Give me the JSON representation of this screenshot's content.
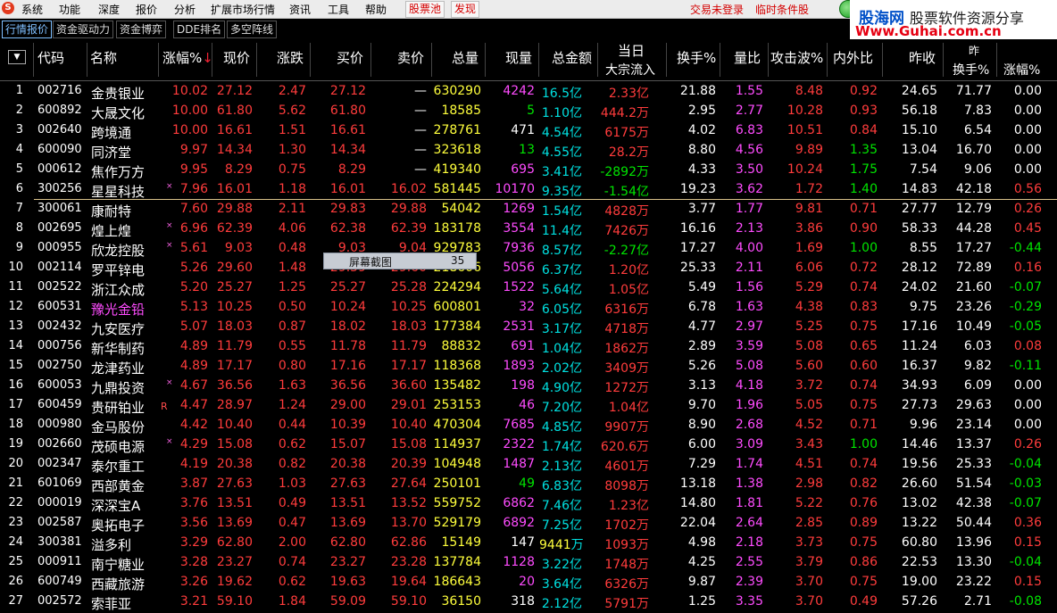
{
  "menubar": {
    "logo": "S",
    "items": [
      "系统",
      "功能",
      "深度",
      "报价",
      "分析",
      "扩展市场行情",
      "资讯",
      "工具",
      "帮助"
    ],
    "pills": [
      "股票池",
      "发现"
    ],
    "status": [
      "交易未登录",
      "临时条件股"
    ]
  },
  "watermark": {
    "title_a": "股海网",
    "title_b": "股票软件资源分享",
    "url": "Www.Guhai.com.cn"
  },
  "tabs": [
    "行情报价",
    "资金驱动力",
    "资金博弈",
    "DDE排名",
    "多空阵线"
  ],
  "header": {
    "code": "代码",
    "name": "名称",
    "pct": "涨幅%",
    "price": "现价",
    "chg": "涨跌",
    "bid": "买价",
    "ask": "卖价",
    "vol": "总量",
    "cur": "现量",
    "amount": "总金额",
    "today": "当日",
    "inflow": "大宗流入",
    "turnover": "换手%",
    "volratio": "量比",
    "attack": "攻击波%",
    "inout": "内外比",
    "prevclose": "昨收",
    "extra_top": "昨",
    "turnover2": "换手%",
    "pct2": "涨幅%"
  },
  "popup": {
    "label": "屏幕截图",
    "value": "35"
  },
  "colors": {
    "red": "#ff3c3c",
    "green": "#00e400",
    "cyan": "#00e0e0",
    "yellow": "#ffff3c",
    "magenta": "#ff4cff",
    "white": "#ffffff"
  },
  "rows": [
    {
      "i": "1",
      "code": "002716",
      "name": "金贵银业",
      "pct": "10.02",
      "price": "27.12",
      "chg": "2.47",
      "bid": "27.12",
      "ask": "—",
      "vol": "630290",
      "cur": "4242",
      "amt": "16.5",
      "amtu": "亿",
      "flow": "2.33",
      "flowu": "亿",
      "to": "21.88",
      "vr": "1.55",
      "aw": "8.48",
      "io": "0.92",
      "pc": "24.65",
      "to2": "71.77",
      "p2": "0.00",
      "pcol": "red",
      "curcol": "magenta",
      "flowcol": "red",
      "p2col": "white"
    },
    {
      "i": "2",
      "code": "600892",
      "name": "大晟文化",
      "pct": "10.00",
      "price": "61.80",
      "chg": "5.62",
      "bid": "61.80",
      "ask": "—",
      "vol": "18585",
      "cur": "5",
      "amt": "1.10",
      "amtu": "亿",
      "flow": "444.2",
      "flowu": "万",
      "to": "2.95",
      "vr": "2.77",
      "aw": "10.28",
      "io": "0.93",
      "pc": "56.18",
      "to2": "7.83",
      "p2": "0.00",
      "pcol": "red",
      "curcol": "green",
      "flowcol": "red",
      "p2col": "white"
    },
    {
      "i": "3",
      "code": "002640",
      "name": "跨境通",
      "pct": "10.00",
      "price": "16.61",
      "chg": "1.51",
      "bid": "16.61",
      "ask": "—",
      "vol": "278761",
      "cur": "471",
      "amt": "4.54",
      "amtu": "亿",
      "flow": "6175",
      "flowu": "万",
      "to": "4.02",
      "vr": "6.83",
      "aw": "10.51",
      "io": "0.84",
      "pc": "15.10",
      "to2": "6.54",
      "p2": "0.00",
      "pcol": "red",
      "curcol": "white",
      "flowcol": "red",
      "p2col": "white"
    },
    {
      "i": "4",
      "code": "600090",
      "name": "同济堂",
      "pct": "9.97",
      "price": "14.34",
      "chg": "1.30",
      "bid": "14.34",
      "ask": "—",
      "vol": "323618",
      "cur": "13",
      "amt": "4.55",
      "amtu": "亿",
      "flow": "28.2",
      "flowu": "万",
      "to": "8.80",
      "vr": "4.56",
      "aw": "9.89",
      "io": "1.35",
      "pc": "13.04",
      "to2": "16.70",
      "p2": "0.00",
      "pcol": "red",
      "curcol": "green",
      "flowcol": "red",
      "p2col": "white",
      "iocol": "green"
    },
    {
      "i": "5",
      "code": "000612",
      "name": "焦作万方",
      "pct": "9.95",
      "price": "8.29",
      "chg": "0.75",
      "bid": "8.29",
      "ask": "—",
      "vol": "419340",
      "cur": "695",
      "amt": "3.41",
      "amtu": "亿",
      "flow": "-2892",
      "flowu": "万",
      "to": "4.33",
      "vr": "3.50",
      "aw": "10.24",
      "io": "1.75",
      "pc": "7.54",
      "to2": "9.06",
      "p2": "0.00",
      "pcol": "red",
      "curcol": "magenta",
      "flowcol": "green",
      "p2col": "white",
      "iocol": "green"
    },
    {
      "i": "6",
      "code": "300256",
      "name": "星星科技",
      "pct": "7.96",
      "price": "16.01",
      "chg": "1.18",
      "bid": "16.01",
      "ask": "16.02",
      "vol": "581445",
      "cur": "10170",
      "amt": "9.35",
      "amtu": "亿",
      "flow": "-1.54",
      "flowu": "亿",
      "to": "19.23",
      "vr": "3.62",
      "aw": "1.72",
      "io": "1.40",
      "pc": "14.83",
      "to2": "42.18",
      "p2": "0.56",
      "pcol": "red",
      "curcol": "magenta",
      "flowcol": "green",
      "p2col": "red",
      "iocol": "green",
      "mark": "×"
    },
    {
      "i": "7",
      "code": "300061",
      "name": "康耐特",
      "pct": "7.60",
      "price": "29.88",
      "chg": "2.11",
      "bid": "29.83",
      "ask": "29.88",
      "vol": "54042",
      "cur": "1269",
      "amt": "1.54",
      "amtu": "亿",
      "flow": "4828",
      "flowu": "万",
      "to": "3.77",
      "vr": "1.77",
      "aw": "9.81",
      "io": "0.71",
      "pc": "27.77",
      "to2": "12.79",
      "p2": "0.26",
      "pcol": "red",
      "curcol": "magenta",
      "flowcol": "red",
      "p2col": "red"
    },
    {
      "i": "8",
      "code": "002695",
      "name": "煌上煌",
      "pct": "6.96",
      "price": "62.39",
      "chg": "4.06",
      "bid": "62.38",
      "ask": "62.39",
      "vol": "183178",
      "cur": "3554",
      "amt": "11.4",
      "amtu": "亿",
      "flow": "7426",
      "flowu": "万",
      "to": "16.16",
      "vr": "2.13",
      "aw": "3.86",
      "io": "0.90",
      "pc": "58.33",
      "to2": "44.28",
      "p2": "0.45",
      "pcol": "red",
      "curcol": "magenta",
      "flowcol": "red",
      "p2col": "red",
      "mark": "×"
    },
    {
      "i": "9",
      "code": "000955",
      "name": "欣龙控股",
      "pct": "5.61",
      "price": "9.03",
      "chg": "0.48",
      "bid": "9.03",
      "ask": "9.04",
      "vol": "929783",
      "cur": "7936",
      "amt": "8.57",
      "amtu": "亿",
      "flow": "-2.27",
      "flowu": "亿",
      "to": "17.27",
      "vr": "4.00",
      "aw": "1.69",
      "io": "1.00",
      "pc": "8.55",
      "to2": "17.27",
      "p2": "-0.44",
      "pcol": "red",
      "curcol": "magenta",
      "flowcol": "green",
      "p2col": "green",
      "iocol": "green",
      "mark": "×"
    },
    {
      "i": "10",
      "code": "002114",
      "name": "罗平锌电",
      "pct": "5.26",
      "price": "29.60",
      "chg": "1.48",
      "bid": "29.59",
      "ask": "29.60",
      "vol": "218606",
      "cur": "5056",
      "amt": "6.37",
      "amtu": "亿",
      "flow": "1.20",
      "flowu": "亿",
      "to": "25.33",
      "vr": "2.11",
      "aw": "6.06",
      "io": "0.72",
      "pc": "28.12",
      "to2": "72.89",
      "p2": "0.16",
      "pcol": "red",
      "curcol": "magenta",
      "flowcol": "red",
      "p2col": "red"
    },
    {
      "i": "11",
      "code": "002522",
      "name": "浙江众成",
      "pct": "5.20",
      "price": "25.27",
      "chg": "1.25",
      "bid": "25.27",
      "ask": "25.28",
      "vol": "224294",
      "cur": "1522",
      "amt": "5.64",
      "amtu": "亿",
      "flow": "1.05",
      "flowu": "亿",
      "to": "5.49",
      "vr": "1.56",
      "aw": "5.29",
      "io": "0.74",
      "pc": "24.02",
      "to2": "21.60",
      "p2": "-0.07",
      "pcol": "red",
      "curcol": "magenta",
      "flowcol": "red",
      "p2col": "green"
    },
    {
      "i": "12",
      "code": "600531",
      "name": "豫光金铅",
      "pct": "5.13",
      "price": "10.25",
      "chg": "0.50",
      "bid": "10.24",
      "ask": "10.25",
      "vol": "600801",
      "cur": "32",
      "amt": "6.05",
      "amtu": "亿",
      "flow": "6316",
      "flowu": "万",
      "to": "6.78",
      "vr": "1.63",
      "aw": "4.38",
      "io": "0.83",
      "pc": "9.75",
      "to2": "23.26",
      "p2": "-0.29",
      "pcol": "red",
      "curcol": "magenta",
      "flowcol": "red",
      "p2col": "green",
      "namecol": "magenta"
    },
    {
      "i": "13",
      "code": "002432",
      "name": "九安医疗",
      "pct": "5.07",
      "price": "18.03",
      "chg": "0.87",
      "bid": "18.02",
      "ask": "18.03",
      "vol": "177384",
      "cur": "2531",
      "amt": "3.17",
      "amtu": "亿",
      "flow": "4718",
      "flowu": "万",
      "to": "4.77",
      "vr": "2.97",
      "aw": "5.25",
      "io": "0.75",
      "pc": "17.16",
      "to2": "10.49",
      "p2": "-0.05",
      "pcol": "red",
      "curcol": "magenta",
      "flowcol": "red",
      "p2col": "green"
    },
    {
      "i": "14",
      "code": "000756",
      "name": "新华制药",
      "pct": "4.89",
      "price": "11.79",
      "chg": "0.55",
      "bid": "11.78",
      "ask": "11.79",
      "vol": "88832",
      "cur": "691",
      "amt": "1.04",
      "amtu": "亿",
      "flow": "1862",
      "flowu": "万",
      "to": "2.89",
      "vr": "3.59",
      "aw": "5.08",
      "io": "0.65",
      "pc": "11.24",
      "to2": "6.03",
      "p2": "0.08",
      "pcol": "red",
      "curcol": "magenta",
      "flowcol": "red",
      "p2col": "red"
    },
    {
      "i": "15",
      "code": "002750",
      "name": "龙津药业",
      "pct": "4.89",
      "price": "17.17",
      "chg": "0.80",
      "bid": "17.16",
      "ask": "17.17",
      "vol": "118368",
      "cur": "1893",
      "amt": "2.02",
      "amtu": "亿",
      "flow": "3409",
      "flowu": "万",
      "to": "5.26",
      "vr": "5.08",
      "aw": "5.60",
      "io": "0.60",
      "pc": "16.37",
      "to2": "9.82",
      "p2": "-0.11",
      "pcol": "red",
      "curcol": "magenta",
      "flowcol": "red",
      "p2col": "green"
    },
    {
      "i": "16",
      "code": "600053",
      "name": "九鼎投资",
      "pct": "4.67",
      "price": "36.56",
      "chg": "1.63",
      "bid": "36.56",
      "ask": "36.60",
      "vol": "135482",
      "cur": "198",
      "amt": "4.90",
      "amtu": "亿",
      "flow": "1272",
      "flowu": "万",
      "to": "3.13",
      "vr": "4.18",
      "aw": "3.72",
      "io": "0.74",
      "pc": "34.93",
      "to2": "6.09",
      "p2": "0.00",
      "pcol": "red",
      "curcol": "magenta",
      "flowcol": "red",
      "p2col": "white",
      "mark": "×"
    },
    {
      "i": "17",
      "code": "600459",
      "name": "贵研铂业",
      "pct": "4.47",
      "price": "28.97",
      "chg": "1.24",
      "bid": "29.00",
      "ask": "29.01",
      "vol": "253153",
      "cur": "46",
      "amt": "7.20",
      "amtu": "亿",
      "flow": "1.04",
      "flowu": "亿",
      "to": "9.70",
      "vr": "1.96",
      "aw": "5.05",
      "io": "0.75",
      "pc": "27.73",
      "to2": "29.63",
      "p2": "0.00",
      "pcol": "red",
      "curcol": "magenta",
      "flowcol": "red",
      "p2col": "white",
      "mark": "R"
    },
    {
      "i": "18",
      "code": "000980",
      "name": "金马股份",
      "pct": "4.42",
      "price": "10.40",
      "chg": "0.44",
      "bid": "10.39",
      "ask": "10.40",
      "vol": "470304",
      "cur": "7685",
      "amt": "4.85",
      "amtu": "亿",
      "flow": "9907",
      "flowu": "万",
      "to": "8.90",
      "vr": "2.68",
      "aw": "4.52",
      "io": "0.71",
      "pc": "9.96",
      "to2": "23.14",
      "p2": "0.00",
      "pcol": "red",
      "curcol": "magenta",
      "flowcol": "red",
      "p2col": "white"
    },
    {
      "i": "19",
      "code": "002660",
      "name": "茂硕电源",
      "pct": "4.29",
      "price": "15.08",
      "chg": "0.62",
      "bid": "15.07",
      "ask": "15.08",
      "vol": "114937",
      "cur": "2322",
      "amt": "1.74",
      "amtu": "亿",
      "flow": "620.6",
      "flowu": "万",
      "to": "6.00",
      "vr": "3.09",
      "aw": "3.43",
      "io": "1.00",
      "pc": "14.46",
      "to2": "13.37",
      "p2": "0.26",
      "pcol": "red",
      "curcol": "magenta",
      "flowcol": "red",
      "p2col": "red",
      "iocol": "green",
      "mark": "×"
    },
    {
      "i": "20",
      "code": "002347",
      "name": "泰尔重工",
      "pct": "4.19",
      "price": "20.38",
      "chg": "0.82",
      "bid": "20.38",
      "ask": "20.39",
      "vol": "104948",
      "cur": "1487",
      "amt": "2.13",
      "amtu": "亿",
      "flow": "4601",
      "flowu": "万",
      "to": "7.29",
      "vr": "1.74",
      "aw": "4.51",
      "io": "0.74",
      "pc": "19.56",
      "to2": "25.33",
      "p2": "-0.04",
      "pcol": "red",
      "curcol": "magenta",
      "flowcol": "red",
      "p2col": "green"
    },
    {
      "i": "21",
      "code": "601069",
      "name": "西部黄金",
      "pct": "3.87",
      "price": "27.63",
      "chg": "1.03",
      "bid": "27.63",
      "ask": "27.64",
      "vol": "250101",
      "cur": "49",
      "amt": "6.83",
      "amtu": "亿",
      "flow": "8098",
      "flowu": "万",
      "to": "13.18",
      "vr": "1.38",
      "aw": "2.98",
      "io": "0.82",
      "pc": "26.60",
      "to2": "51.54",
      "p2": "-0.03",
      "pcol": "red",
      "curcol": "green",
      "flowcol": "red",
      "p2col": "green"
    },
    {
      "i": "22",
      "code": "000019",
      "name": "深深宝A",
      "pct": "3.76",
      "price": "13.51",
      "chg": "0.49",
      "bid": "13.51",
      "ask": "13.52",
      "vol": "559752",
      "cur": "6862",
      "amt": "7.46",
      "amtu": "亿",
      "flow": "1.23",
      "flowu": "亿",
      "to": "14.80",
      "vr": "1.81",
      "aw": "5.22",
      "io": "0.76",
      "pc": "13.02",
      "to2": "42.38",
      "p2": "-0.07",
      "pcol": "red",
      "curcol": "magenta",
      "flowcol": "red",
      "p2col": "green"
    },
    {
      "i": "23",
      "code": "002587",
      "name": "奥拓电子",
      "pct": "3.56",
      "price": "13.69",
      "chg": "0.47",
      "bid": "13.69",
      "ask": "13.70",
      "vol": "529179",
      "cur": "6892",
      "amt": "7.25",
      "amtu": "亿",
      "flow": "1702",
      "flowu": "万",
      "to": "22.04",
      "vr": "2.64",
      "aw": "2.85",
      "io": "0.89",
      "pc": "13.22",
      "to2": "50.44",
      "p2": "0.36",
      "pcol": "red",
      "curcol": "magenta",
      "flowcol": "red",
      "p2col": "red"
    },
    {
      "i": "24",
      "code": "300381",
      "name": "溢多利",
      "pct": "3.29",
      "price": "62.80",
      "chg": "2.00",
      "bid": "62.80",
      "ask": "62.86",
      "vol": "15149",
      "cur": "147",
      "amt": "9441",
      "amtu": "万",
      "flow": "1093",
      "flowu": "万",
      "to": "4.98",
      "vr": "2.18",
      "aw": "3.73",
      "io": "0.75",
      "pc": "60.80",
      "to2": "13.96",
      "p2": "0.15",
      "pcol": "red",
      "curcol": "white",
      "flowcol": "red",
      "p2col": "red",
      "amtcol": "yellow"
    },
    {
      "i": "25",
      "code": "000911",
      "name": "南宁糖业",
      "pct": "3.28",
      "price": "23.27",
      "chg": "0.74",
      "bid": "23.27",
      "ask": "23.28",
      "vol": "137784",
      "cur": "1128",
      "amt": "3.22",
      "amtu": "亿",
      "flow": "1748",
      "flowu": "万",
      "to": "4.25",
      "vr": "2.55",
      "aw": "3.79",
      "io": "0.86",
      "pc": "22.53",
      "to2": "13.30",
      "p2": "-0.04",
      "pcol": "red",
      "curcol": "magenta",
      "flowcol": "red",
      "p2col": "green"
    },
    {
      "i": "26",
      "code": "600749",
      "name": "西藏旅游",
      "pct": "3.26",
      "price": "19.62",
      "chg": "0.62",
      "bid": "19.63",
      "ask": "19.64",
      "vol": "186643",
      "cur": "20",
      "amt": "3.64",
      "amtu": "亿",
      "flow": "6326",
      "flowu": "万",
      "to": "9.87",
      "vr": "2.39",
      "aw": "3.70",
      "io": "0.75",
      "pc": "19.00",
      "to2": "23.22",
      "p2": "0.15",
      "pcol": "red",
      "curcol": "magenta",
      "flowcol": "red",
      "p2col": "red"
    },
    {
      "i": "27",
      "code": "002572",
      "name": "索菲亚",
      "pct": "3.21",
      "price": "59.10",
      "chg": "1.84",
      "bid": "59.09",
      "ask": "59.10",
      "vol": "36150",
      "cur": "318",
      "amt": "2.12",
      "amtu": "亿",
      "flow": "5791",
      "flowu": "万",
      "to": "1.25",
      "vr": "3.35",
      "aw": "3.70",
      "io": "0.49",
      "pc": "57.26",
      "to2": "2.71",
      "p2": "-0.08",
      "pcol": "red",
      "curcol": "white",
      "flowcol": "red",
      "p2col": "green"
    }
  ]
}
